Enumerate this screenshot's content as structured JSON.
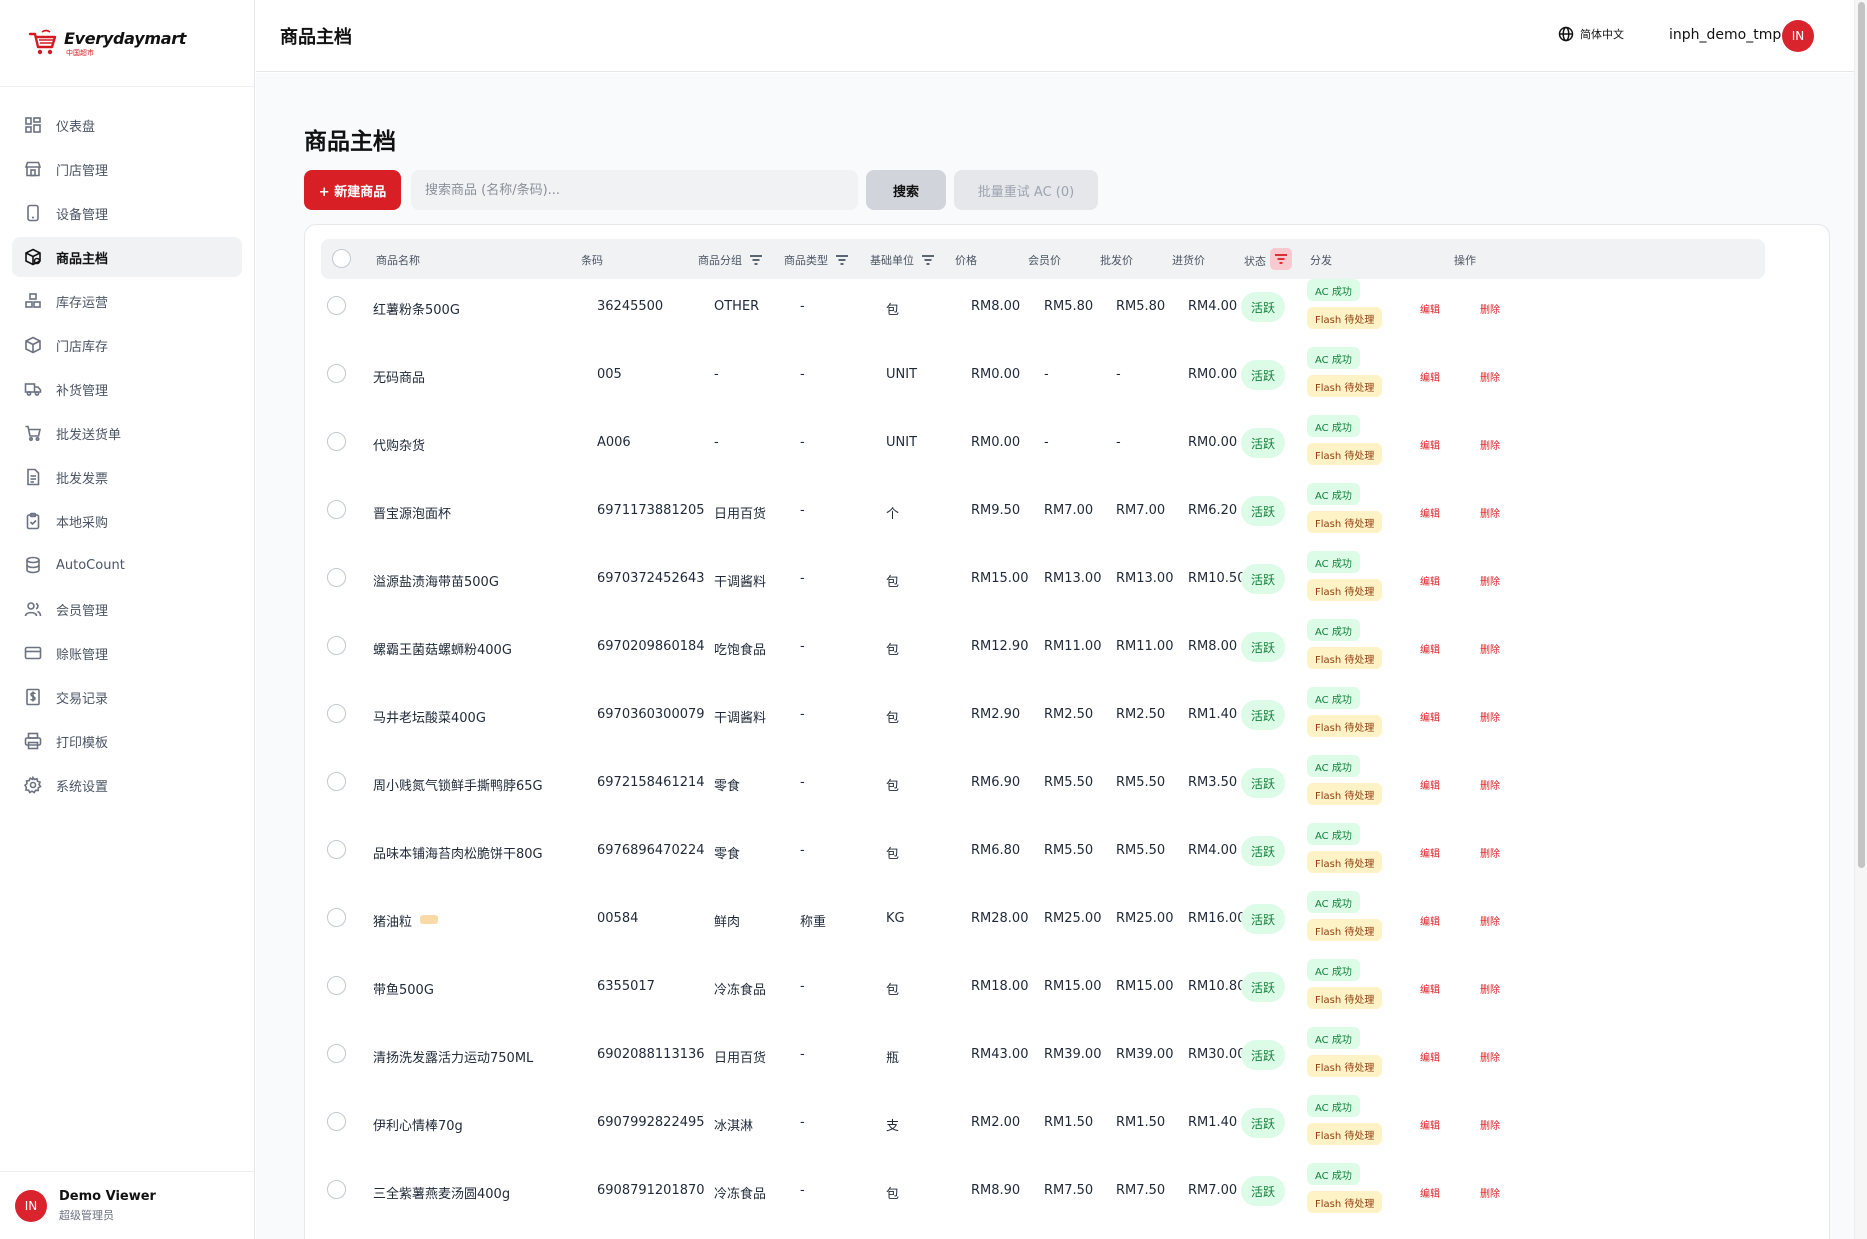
{
  "brand": {
    "name": "Everydaymart",
    "sub": "中国超市",
    "color": "#d31a24"
  },
  "sidebar": {
    "items": [
      {
        "label": "仪表盘",
        "icon": "dashboard-icon"
      },
      {
        "label": "门店管理",
        "icon": "store-icon"
      },
      {
        "label": "设备管理",
        "icon": "device-icon"
      },
      {
        "label": "商品主档",
        "icon": "product-icon",
        "active": true
      },
      {
        "label": "库存运营",
        "icon": "inventory-ops-icon"
      },
      {
        "label": "门店库存",
        "icon": "box-icon"
      },
      {
        "label": "补货管理",
        "icon": "truck-icon"
      },
      {
        "label": "批发送货单",
        "icon": "cart-icon"
      },
      {
        "label": "批发发票",
        "icon": "invoice-icon"
      },
      {
        "label": "本地采购",
        "icon": "clipboard-icon"
      },
      {
        "label": "AutoCount",
        "icon": "database-icon"
      },
      {
        "label": "会员管理",
        "icon": "members-icon"
      },
      {
        "label": "赊账管理",
        "icon": "credit-card-icon"
      },
      {
        "label": "交易记录",
        "icon": "dollar-doc-icon"
      },
      {
        "label": "打印模板",
        "icon": "printer-icon"
      },
      {
        "label": "系统设置",
        "icon": "gear-icon"
      }
    ],
    "user": {
      "initials": "IN",
      "name": "Demo Viewer",
      "role": "超级管理员"
    }
  },
  "header": {
    "title": "商品主档",
    "language": "简体中文",
    "username": "inph_demo_tmp",
    "avatar_initials": "IN"
  },
  "main": {
    "title": "商品主档",
    "new_button": "+ 新建商品",
    "search_placeholder": "搜索商品 (名称/条码)...",
    "search_button": "搜索",
    "retry_button": "批量重试 AC (0)"
  },
  "table": {
    "columns": {
      "name": "商品名称",
      "barcode": "条码",
      "group": "商品分组",
      "type": "商品类型",
      "unit": "基础单位",
      "price": "价格",
      "member_price": "会员价",
      "wholesale_price": "批发价",
      "cost_price": "进货价",
      "status": "状态",
      "distribution": "分发",
      "actions": "操作"
    },
    "edit_label": "编辑",
    "delete_label": "删除",
    "rows": [
      {
        "name": "红薯粉条500G",
        "barcode": "36245500",
        "group": "OTHER",
        "type": "-",
        "unit": "包",
        "price": "RM8.00",
        "member": "RM5.80",
        "wholesale": "RM5.80",
        "cost": "RM4.00",
        "status": "活跃",
        "ac": "AC 成功",
        "flash": "Flash 待处理"
      },
      {
        "name": "无码商品",
        "barcode": "005",
        "group": "-",
        "type": "-",
        "unit": "UNIT",
        "price": "RM0.00",
        "member": "-",
        "wholesale": "-",
        "cost": "RM0.00",
        "status": "活跃",
        "ac": "AC 成功",
        "flash": "Flash 待处理"
      },
      {
        "name": "代购杂货",
        "barcode": "A006",
        "group": "-",
        "type": "-",
        "unit": "UNIT",
        "price": "RM0.00",
        "member": "-",
        "wholesale": "-",
        "cost": "RM0.00",
        "status": "活跃",
        "ac": "AC 成功",
        "flash": "Flash 待处理"
      },
      {
        "name": "晋宝源泡面杯",
        "barcode": "6971173881205",
        "group": "日用百货",
        "type": "-",
        "unit": "个",
        "price": "RM9.50",
        "member": "RM7.00",
        "wholesale": "RM7.00",
        "cost": "RM6.20",
        "status": "活跃",
        "ac": "AC 成功",
        "flash": "Flash 待处理"
      },
      {
        "name": "溢源盐渍海带苗500G",
        "barcode": "6970372452643",
        "group": "干调酱料",
        "type": "-",
        "unit": "包",
        "price": "RM15.00",
        "member": "RM13.00",
        "wholesale": "RM13.00",
        "cost": "RM10.50",
        "status": "活跃",
        "ac": "AC 成功",
        "flash": "Flash 待处理"
      },
      {
        "name": "螺霸王菌菇螺蛳粉400G",
        "barcode": "6970209860184",
        "group": "吃饱食品",
        "type": "-",
        "unit": "包",
        "price": "RM12.90",
        "member": "RM11.00",
        "wholesale": "RM11.00",
        "cost": "RM8.00",
        "status": "活跃",
        "ac": "AC 成功",
        "flash": "Flash 待处理"
      },
      {
        "name": "马井老坛酸菜400G",
        "barcode": "6970360300079",
        "group": "干调酱料",
        "type": "-",
        "unit": "包",
        "price": "RM2.90",
        "member": "RM2.50",
        "wholesale": "RM2.50",
        "cost": "RM1.40",
        "status": "活跃",
        "ac": "AC 成功",
        "flash": "Flash 待处理"
      },
      {
        "name": "周小贱氮气锁鲜手撕鸭脖65G",
        "barcode": "6972158461214",
        "group": "零食",
        "type": "-",
        "unit": "包",
        "price": "RM6.90",
        "member": "RM5.50",
        "wholesale": "RM5.50",
        "cost": "RM3.50",
        "status": "活跃",
        "ac": "AC 成功",
        "flash": "Flash 待处理"
      },
      {
        "name": "品味本铺海苔肉松脆饼干80G",
        "barcode": "6976896470224",
        "group": "零食",
        "type": "-",
        "unit": "包",
        "price": "RM6.80",
        "member": "RM5.50",
        "wholesale": "RM5.50",
        "cost": "RM4.00",
        "status": "活跃",
        "ac": "AC 成功",
        "flash": "Flash 待处理"
      },
      {
        "name": "猪油粒",
        "barcode": "00584",
        "group": "鲜肉",
        "type": "称重",
        "unit": "KG",
        "price": "RM28.00",
        "member": "RM25.00",
        "wholesale": "RM25.00",
        "cost": "RM16.00",
        "status": "活跃",
        "ac": "AC 成功",
        "flash": "Flash 待处理",
        "tag": true
      },
      {
        "name": "带鱼500G",
        "barcode": "6355017",
        "group": "冷冻食品",
        "type": "-",
        "unit": "包",
        "price": "RM18.00",
        "member": "RM15.00",
        "wholesale": "RM15.00",
        "cost": "RM10.80",
        "status": "活跃",
        "ac": "AC 成功",
        "flash": "Flash 待处理"
      },
      {
        "name": "清扬洗发露活力运动750ML",
        "barcode": "6902088113136",
        "group": "日用百货",
        "type": "-",
        "unit": "瓶",
        "price": "RM43.00",
        "member": "RM39.00",
        "wholesale": "RM39.00",
        "cost": "RM30.00",
        "status": "活跃",
        "ac": "AC 成功",
        "flash": "Flash 待处理"
      },
      {
        "name": "伊利心情棒70g",
        "barcode": "6907992822495",
        "group": "冰淇淋",
        "type": "-",
        "unit": "支",
        "price": "RM2.00",
        "member": "RM1.50",
        "wholesale": "RM1.50",
        "cost": "RM1.40",
        "status": "活跃",
        "ac": "AC 成功",
        "flash": "Flash 待处理"
      },
      {
        "name": "三全紫薯燕麦汤圆400g",
        "barcode": "6908791201870",
        "group": "冷冻食品",
        "type": "-",
        "unit": "包",
        "price": "RM8.90",
        "member": "RM7.50",
        "wholesale": "RM7.50",
        "cost": "RM7.00",
        "status": "活跃",
        "ac": "AC 成功",
        "flash": "Flash 待处理"
      }
    ]
  },
  "colors": {
    "accent": "#d91f26",
    "success_bg": "#dcfce7",
    "success_text": "#15803d",
    "pending_bg": "#fef3c7",
    "pending_text": "#92400e"
  }
}
